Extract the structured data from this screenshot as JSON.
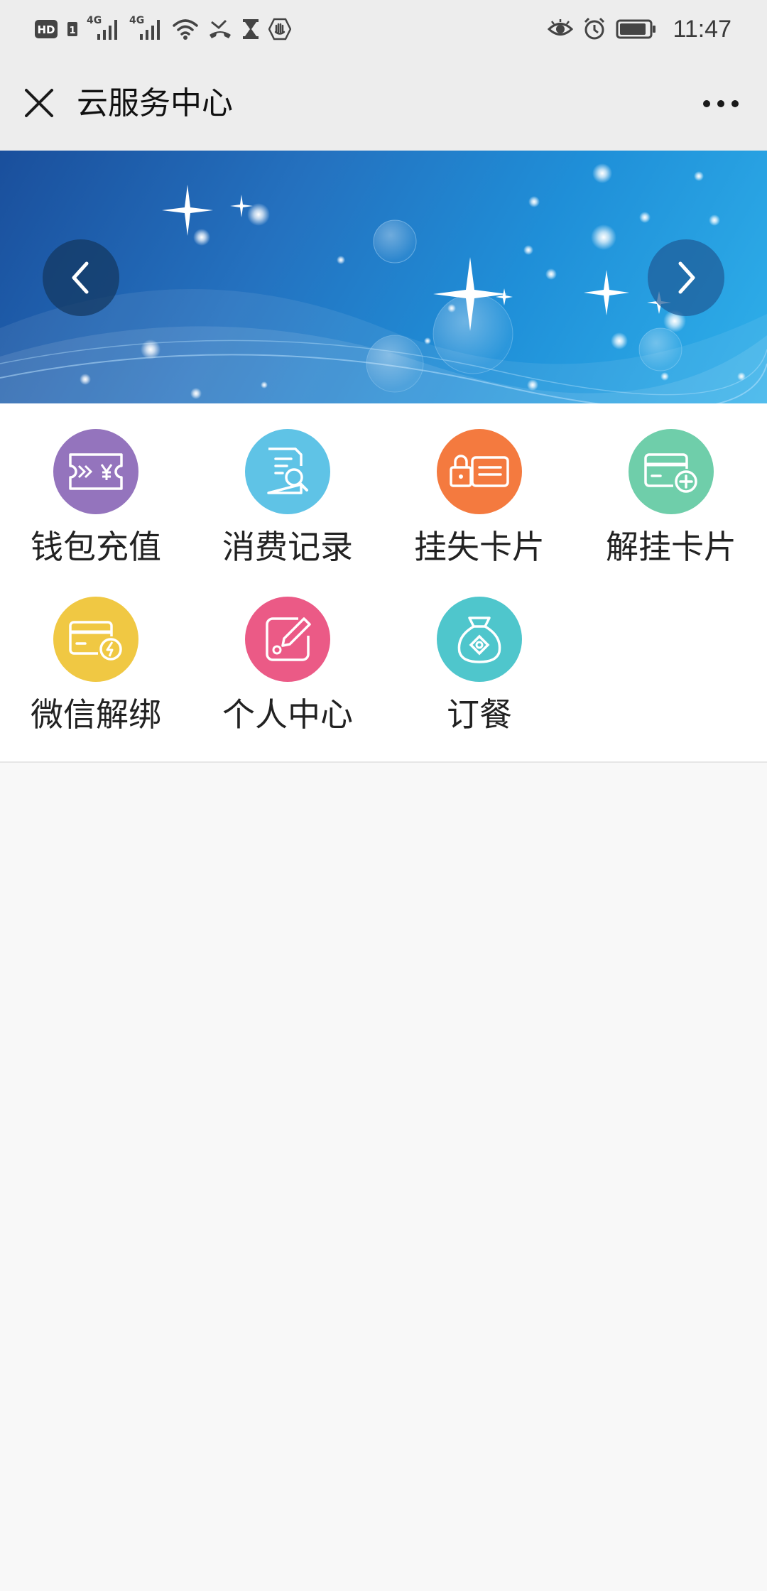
{
  "status_bar": {
    "left_indicators": [
      "hd-icon",
      "sim-1-icon",
      "signal-4g-icon",
      "signal-4g-icon",
      "wifi-icon",
      "missed-call-icon",
      "hourglass-icon",
      "hand-icon"
    ],
    "network_1": "4G",
    "network_2": "4G",
    "right_indicators": [
      "eye-icon",
      "alarm-icon",
      "battery-icon"
    ],
    "time": "11:47"
  },
  "header": {
    "title": "云服务中心",
    "close_icon": "close-icon",
    "more_icon": "more-dots-icon"
  },
  "banner": {
    "prev_icon": "chevron-left-icon",
    "next_icon": "chevron-right-icon"
  },
  "grid": {
    "items": [
      {
        "label": "钱包充值",
        "icon": "wallet-recharge-icon",
        "color": "#9474bd"
      },
      {
        "label": "消费记录",
        "icon": "consumption-record-icon",
        "color": "#5fc3e6"
      },
      {
        "label": "挂失卡片",
        "icon": "report-loss-card-icon",
        "color": "#f47a3f"
      },
      {
        "label": "解挂卡片",
        "icon": "unlock-card-icon",
        "color": "#6fceaa"
      },
      {
        "label": "微信解绑",
        "icon": "wechat-unbind-icon",
        "color": "#f0c843"
      },
      {
        "label": "个人中心",
        "icon": "personal-center-icon",
        "color": "#eb5a86"
      },
      {
        "label": "订餐",
        "icon": "order-meal-icon",
        "color": "#4fc6cc"
      }
    ]
  }
}
